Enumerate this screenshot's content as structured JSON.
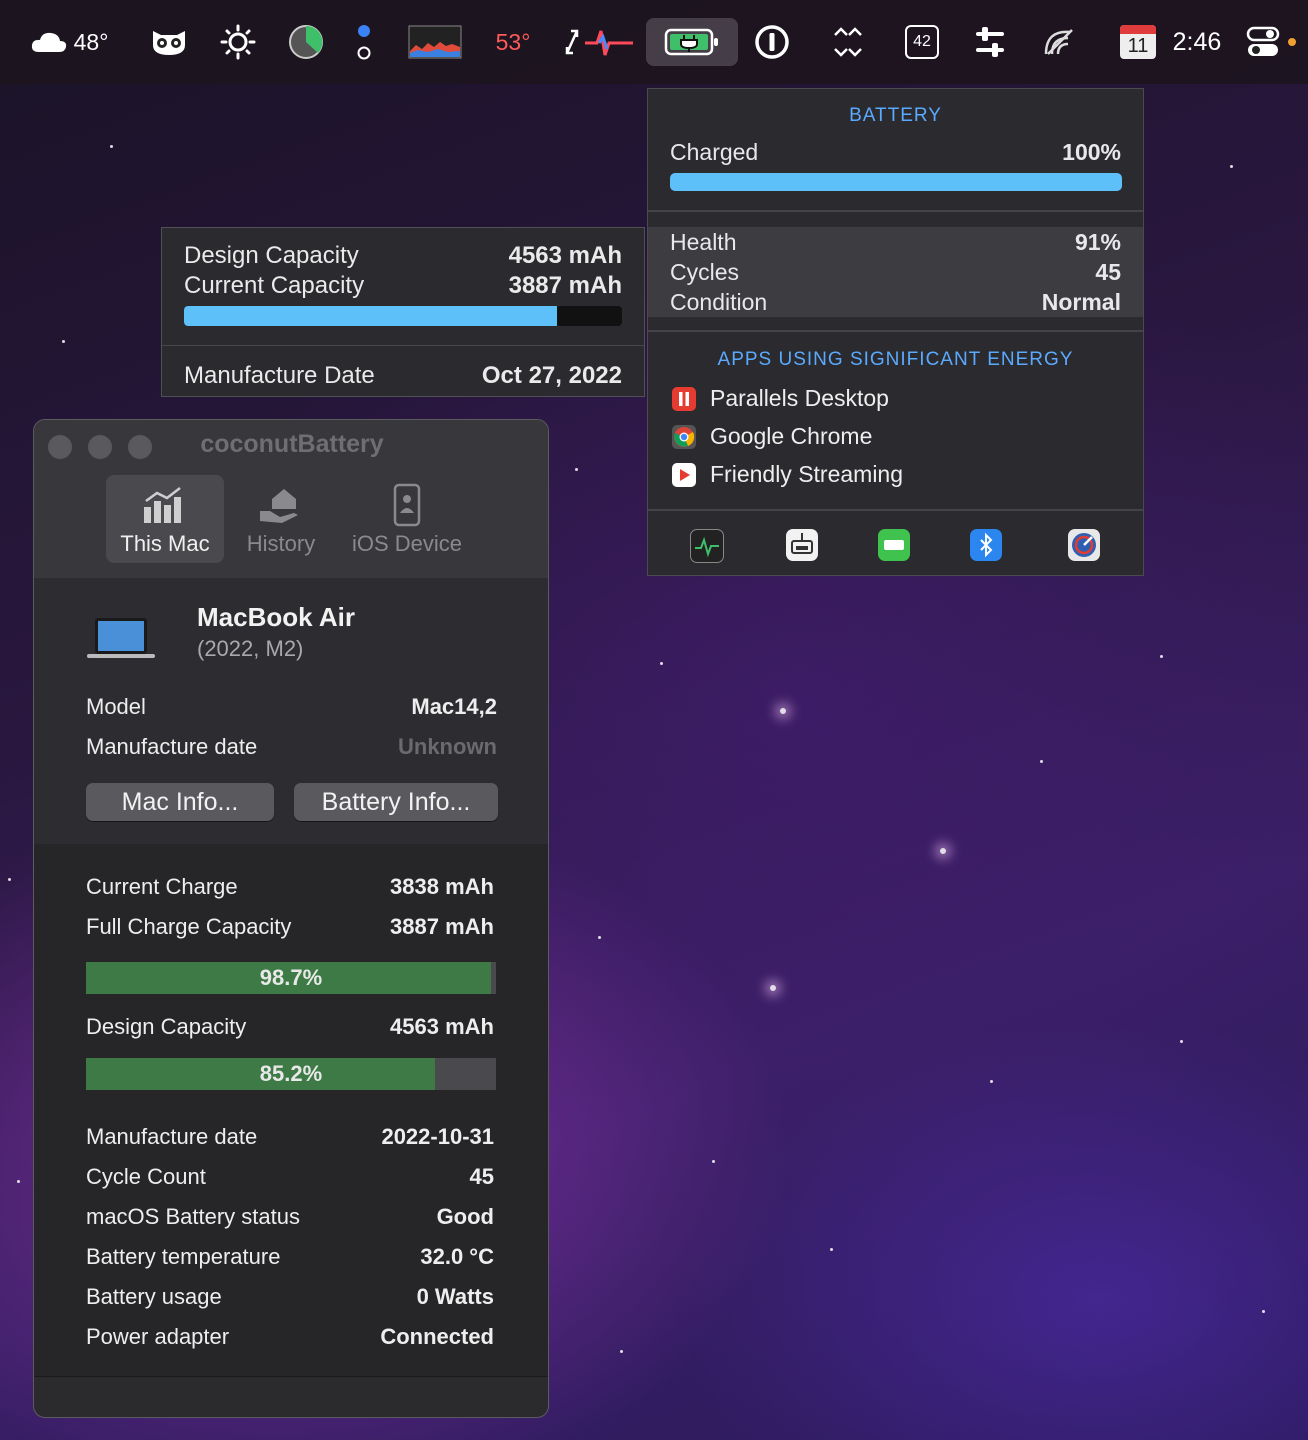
{
  "menubar": {
    "weather_temp": "48°",
    "cpu_temp": "53°",
    "badge_number": "42",
    "calendar_day": "11",
    "clock": "2:46"
  },
  "battery_popup": {
    "title": "BATTERY",
    "charged_label": "Charged",
    "charged_value": "100%",
    "charge_level": 1.0,
    "health_label": "Health",
    "health_value": "91%",
    "cycles_label": "Cycles",
    "cycles_value": "45",
    "condition_label": "Condition",
    "condition_value": "Normal",
    "apps_title": "APPS USING SIGNIFICANT ENERGY",
    "apps": [
      {
        "name": "Parallels Desktop",
        "icon": "parallels-icon"
      },
      {
        "name": "Google Chrome",
        "icon": "chrome-icon"
      },
      {
        "name": "Friendly Streaming",
        "icon": "streaming-icon"
      }
    ],
    "footer_icons": [
      "activity-monitor-icon",
      "network-utility-icon",
      "battery-settings-icon",
      "bluetooth-icon",
      "disk-utility-icon"
    ]
  },
  "capacity_tooltip": {
    "design_label": "Design Capacity",
    "design_value": "4563 mAh",
    "current_label": "Current Capacity",
    "current_value": "3887 mAh",
    "capacity_ratio": 0.852,
    "manufacture_label": "Manufacture Date",
    "manufacture_value": "Oct 27, 2022"
  },
  "coconut": {
    "title": "coconutBattery",
    "tabs": [
      {
        "label": "This Mac",
        "icon": "chart-icon",
        "selected": true
      },
      {
        "label": "History",
        "icon": "house-hand-icon",
        "selected": false
      },
      {
        "label": "iOS Device",
        "icon": "phone-icon",
        "selected": false
      }
    ],
    "device_name": "MacBook Air",
    "device_sub": "(2022, M2)",
    "model_label": "Model",
    "model_value": "Mac14,2",
    "mfg_label": "Manufacture date",
    "mfg_value": "Unknown",
    "mac_info_button": "Mac Info...",
    "battery_info_button": "Battery Info...",
    "current_charge_label": "Current Charge",
    "current_charge_value": "3838 mAh",
    "full_charge_label": "Full Charge Capacity",
    "full_charge_value": "3887 mAh",
    "charge_pct_text": "98.7%",
    "charge_pct": 0.987,
    "design_label": "Design Capacity",
    "design_value": "4563 mAh",
    "design_pct_text": "85.2%",
    "design_pct": 0.852,
    "details": [
      {
        "label": "Manufacture date",
        "value": "2022-10-31"
      },
      {
        "label": "Cycle Count",
        "value": "45"
      },
      {
        "label": "macOS Battery status",
        "value": "Good"
      },
      {
        "label": "Battery temperature",
        "value": "32.0 °C"
      },
      {
        "label": "Battery usage",
        "value": "0 Watts"
      },
      {
        "label": "Power adapter",
        "value": "Connected"
      }
    ]
  }
}
